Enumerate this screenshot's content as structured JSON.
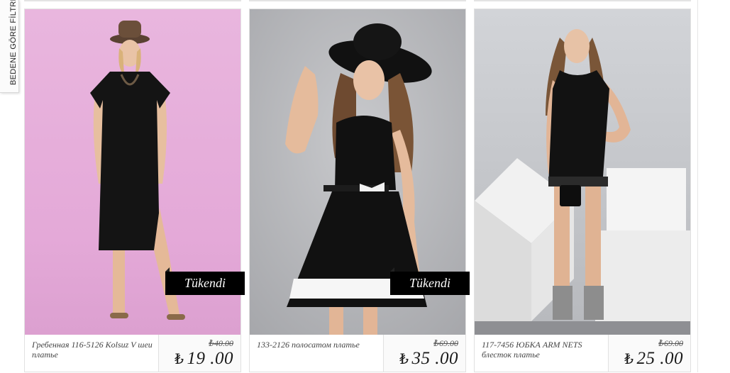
{
  "filter_tab": {
    "label": "BEDENE GÖRE FİLTRE"
  },
  "currency_symbol": "₺",
  "products": [
    {
      "name": "Гребенная 116-5126 Kolsuz V шеи платье",
      "old_price": "₺40.00",
      "price": "19 .00",
      "badge": "Tükendi",
      "bg_color": "#e6b0da"
    },
    {
      "name": "133-2126 полосатом платье",
      "old_price": "₺69.00",
      "price": "35 .00",
      "badge": "Tükendi",
      "bg_color": "#b9babd"
    },
    {
      "name": "117-7456 ЮБКА ARM NETS блесток платье",
      "old_price": "₺69.00",
      "price": "25 .00",
      "badge": "",
      "bg_color": "#c4c6ca"
    }
  ]
}
